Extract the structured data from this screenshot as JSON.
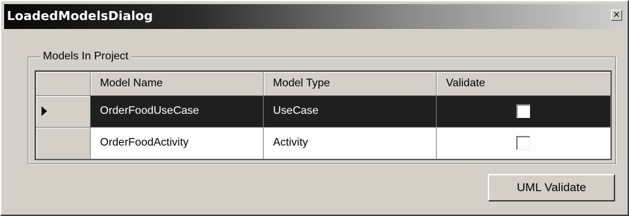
{
  "window": {
    "title": "LoadedModelsDialog",
    "close_glyph": "×"
  },
  "group": {
    "label": "Models In Project"
  },
  "grid": {
    "columns": [
      "Model Name",
      "Model Type",
      "Validate"
    ],
    "rows": [
      {
        "model_name": "OrderFoodUseCase",
        "model_type": "UseCase",
        "validate": false,
        "selected": true
      },
      {
        "model_name": "OrderFoodActivity",
        "model_type": "Activity",
        "validate": false,
        "selected": false
      }
    ]
  },
  "buttons": {
    "uml_validate": "UML Validate"
  },
  "icons": {
    "row_indicator": "arrow-right-icon",
    "close": "close-icon"
  },
  "colors": {
    "selected_row_bg": "#1f1f1f",
    "selected_row_fg": "#ffffff",
    "dialog_bg": "#d4d0c8"
  }
}
